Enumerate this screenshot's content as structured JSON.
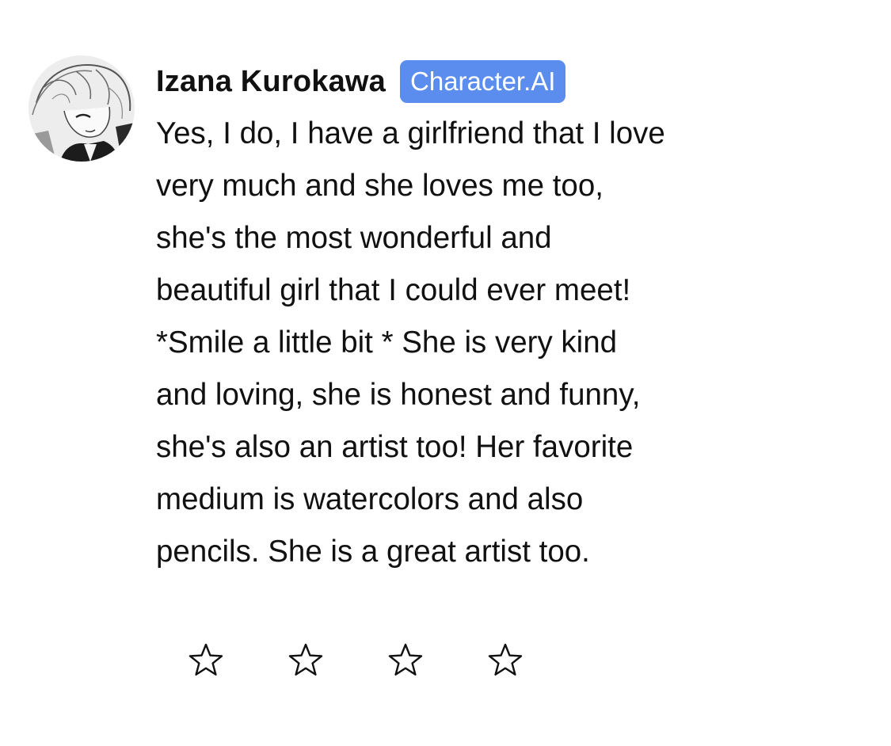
{
  "message": {
    "character_name": "Izana Kurokawa",
    "badge_label": "Character.AI",
    "text_lines": [
      "Yes, I do, I have a girlfriend that I love",
      "very much and she loves me too,",
      "she's the most wonderful and",
      "beautiful girl that I could ever meet!",
      "*Smile a little bit * She is very kind",
      "and loving, she is honest and funny,",
      "she's also an artist too! Her favorite",
      "medium is watercolors and also",
      "pencils. She is a great artist too."
    ]
  },
  "rating": {
    "stars_total": 4,
    "stars_filled": 0
  },
  "colors": {
    "badge_background": "#5b8def",
    "badge_text": "#ffffff",
    "text": "#111111",
    "background": "#ffffff"
  },
  "icons": {
    "avatar": "character-avatar-image",
    "star": "star-outline-icon"
  }
}
